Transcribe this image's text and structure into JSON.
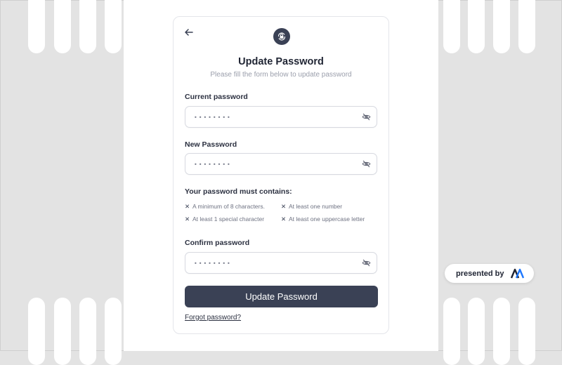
{
  "form": {
    "title": "Update Password",
    "subtitle": "Please fill the form below to update password",
    "current": {
      "label": "Current password",
      "value": "••••••••"
    },
    "new": {
      "label": "New Password",
      "value": "••••••••"
    },
    "confirm": {
      "label": "Confirm password",
      "value": "••••••••"
    },
    "requirements_title": "Your password must contains:",
    "requirements": [
      "A minimum of 8 characters.",
      "At least one number",
      "At least 1 special character",
      "At least one uppercase letter"
    ],
    "submit_label": "Update Password",
    "forgot_label": "Forgot password?"
  },
  "badge": {
    "text": "presented by"
  },
  "colors": {
    "accent": "#3a4155",
    "background": "#e3e3e3",
    "brand_blue": "#1e78ff",
    "brand_dark": "#1f2433"
  },
  "icons": {
    "back": "arrow-left-icon",
    "logo": "lock-refresh-icon",
    "visibility": "eye-off-icon",
    "requirement": "x-mark-icon",
    "brand": "brand-logo-icon"
  }
}
